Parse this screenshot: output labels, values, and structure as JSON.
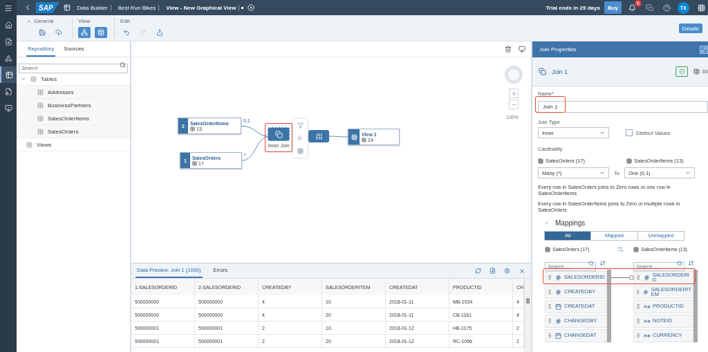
{
  "shell": {
    "logo": "SAP",
    "breadcrumbs": [
      {
        "label": "Data Builder"
      },
      {
        "label": "Best Run Bikes"
      },
      {
        "label": "View - New Graphical View"
      }
    ],
    "unsaved": true,
    "trial": "Trial ends in 29 days",
    "buy": "Buy",
    "notifications": "6",
    "avatar": "TX"
  },
  "rail": [
    {
      "selected": false
    },
    {
      "selected": false
    },
    {
      "selected": false
    },
    {
      "selected": true
    },
    {
      "selected": false
    },
    {
      "selected": false
    }
  ],
  "toolbar": {
    "groups": [
      {
        "label": "General",
        "buttons": [
          {
            "pressed": false,
            "disabled": false
          },
          {
            "pressed": false,
            "disabled": false
          }
        ]
      },
      {
        "label": "View",
        "buttons": [
          {
            "pressed": true,
            "disabled": false
          },
          {
            "pressed": true,
            "disabled": false
          }
        ]
      },
      {
        "label": "Edit",
        "buttons": [
          {
            "pressed": false,
            "disabled": false
          },
          {
            "pressed": false,
            "disabled": true
          },
          {
            "pressed": false,
            "disabled": false
          }
        ]
      }
    ],
    "details": "Details"
  },
  "repository": {
    "tabs": [
      {
        "label": "Repository",
        "selected": true
      },
      {
        "label": "Sources",
        "selected": false
      }
    ],
    "search": {
      "placeholder": "Search"
    },
    "tree": [
      {
        "label": "Tables",
        "expanded": true,
        "children": [
          {
            "label": "Addresses"
          },
          {
            "label": "BusinessPartners"
          },
          {
            "label": "SalesOrderItems"
          },
          {
            "label": "SalesOrders"
          }
        ]
      },
      {
        "label": "Views"
      }
    ]
  },
  "canvas": {
    "nodes": [
      {
        "kind": "source",
        "index": "2",
        "name": "SalesOrderItems",
        "count": "13",
        "cardinality": "0,1"
      },
      {
        "kind": "source",
        "index": "1",
        "name": "SalesOrders",
        "count": "17",
        "cardinality": "*"
      },
      {
        "kind": "join",
        "label": "Inner Join",
        "highlighted": true,
        "tools_label": "fx"
      },
      {
        "kind": "projection"
      },
      {
        "kind": "view",
        "name": "View 1",
        "count": "24"
      }
    ],
    "zoom": "100%"
  },
  "preview": {
    "tabs": [
      {
        "label": "Data Preview: Join 1 (1000)",
        "selected": true
      },
      {
        "label": "Errors",
        "selected": false
      }
    ],
    "columns": [
      "1-SALESORDERID",
      "2-SALESORDERID",
      "CREATEDBY",
      "SALESORDERITEM",
      "CREATEDAT",
      "PRODUCTID",
      "CH"
    ],
    "rows": [
      [
        "500000000",
        "500000000",
        "4",
        "10",
        "2018-01-11",
        "MB-1034",
        "4"
      ],
      [
        "500000000",
        "500000000",
        "4",
        "20",
        "2018-01-11",
        "CB-1161",
        "4"
      ],
      [
        "500000001",
        "500000001",
        "2",
        "10",
        "2018-01-12",
        "HB-1175",
        "2"
      ],
      [
        "500000001",
        "500000001",
        "2",
        "20",
        "2018-01-12",
        "RC-1056",
        "2"
      ]
    ]
  },
  "properties": {
    "title": "Join Properties",
    "object": "Join 1",
    "columns_count": "30",
    "name": {
      "label": "Name",
      "required": true,
      "value": "Join 1",
      "highlighted": true
    },
    "join_type": {
      "label": "Join Type",
      "value": "Inner"
    },
    "distinct": {
      "label": "Distinct Values",
      "checked": false
    },
    "cardinality": {
      "label": "Cardinality",
      "left": {
        "table": "SalesOrders (17)",
        "value": "Many (*)"
      },
      "to": "To",
      "right": {
        "table": "SalesOrderItems (13)",
        "value": "One (0,1)"
      }
    },
    "descriptions": [
      "Every row in SalesOrders joins to Zero rows or one row in SalesOrderItems",
      "Every row in SalesOrderItems joins to Zero or multiple rows in SalesOrders"
    ],
    "mappings": {
      "title": "Mappings",
      "expanded": true,
      "filters": [
        {
          "label": "All",
          "selected": true
        },
        {
          "label": "Mapped",
          "selected": false
        },
        {
          "label": "Unmapped",
          "selected": false
        }
      ],
      "left_table": "SalesOrders (17)",
      "right_table": "SalesOrderItems (13)",
      "left_search": {
        "placeholder": "Search ..."
      },
      "right_search": {
        "placeholder": "Search ..."
      },
      "rows": [
        {
          "left": {
            "kind": "number",
            "name": "SALESORDERID"
          },
          "right": {
            "kind": "number",
            "name": "SALESORDERID"
          },
          "linked": true,
          "highlighted": true
        },
        {
          "left": {
            "kind": "number",
            "name": "CREATEDBY"
          },
          "right": {
            "kind": "number",
            "name": "SALESORDERITEM"
          },
          "linked": false,
          "highlighted": false
        },
        {
          "left": {
            "kind": "date",
            "name": "CREATEDAT"
          },
          "right": {
            "kind": "text",
            "name": "PRODUCTID"
          },
          "linked": false,
          "highlighted": false
        },
        {
          "left": {
            "kind": "number",
            "name": "CHANGEDBY"
          },
          "right": {
            "kind": "text",
            "name": "NOTEID"
          },
          "linked": false,
          "highlighted": false
        },
        {
          "left": {
            "kind": "date",
            "name": "CHANGEDAT"
          },
          "right": {
            "kind": "text",
            "name": "CURRENCY"
          },
          "linked": false,
          "highlighted": false
        }
      ]
    }
  }
}
